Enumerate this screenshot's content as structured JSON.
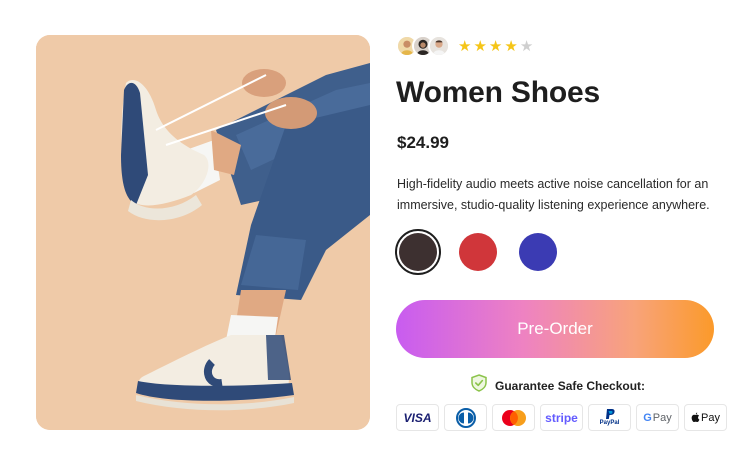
{
  "product": {
    "title": "Women Shoes",
    "price": "$24.99",
    "description": "High-fidelity audio meets active noise cancellation for an immersive, studio-quality listening experience anywhere.",
    "rating": 4,
    "rating_max": 5,
    "image_alt": "Woman in jeans tying sneakers against peach background"
  },
  "reviewers": [
    {
      "icon": "reviewer-avatar-1"
    },
    {
      "icon": "reviewer-avatar-2"
    },
    {
      "icon": "reviewer-avatar-3"
    }
  ],
  "colors": {
    "options": [
      {
        "name": "dark-brown",
        "hex": "#3d3030",
        "selected": true
      },
      {
        "name": "red",
        "hex": "#d0363a",
        "selected": false
      },
      {
        "name": "blue",
        "hex": "#3b3bb3",
        "selected": false
      }
    ],
    "star_on": "#f5c518",
    "star_off": "#cfcfcf",
    "button_gradient": [
      "#c85cf0",
      "#ee82c2",
      "#f8a37a",
      "#fb9a2a"
    ],
    "shield": "#8bc34a"
  },
  "cta": {
    "label": "Pre-Order"
  },
  "checkout": {
    "guarantee_text": "Guarantee Safe Checkout:",
    "shield_icon": "shield-check-icon",
    "payment_methods": [
      {
        "name": "visa",
        "label": "VISA"
      },
      {
        "name": "diners",
        "label": ""
      },
      {
        "name": "mastercard",
        "label": ""
      },
      {
        "name": "stripe",
        "label": "stripe"
      },
      {
        "name": "paypal",
        "label": "PayPal"
      },
      {
        "name": "google-pay",
        "label": "Pay"
      },
      {
        "name": "apple-pay",
        "label": "Pay"
      }
    ]
  }
}
